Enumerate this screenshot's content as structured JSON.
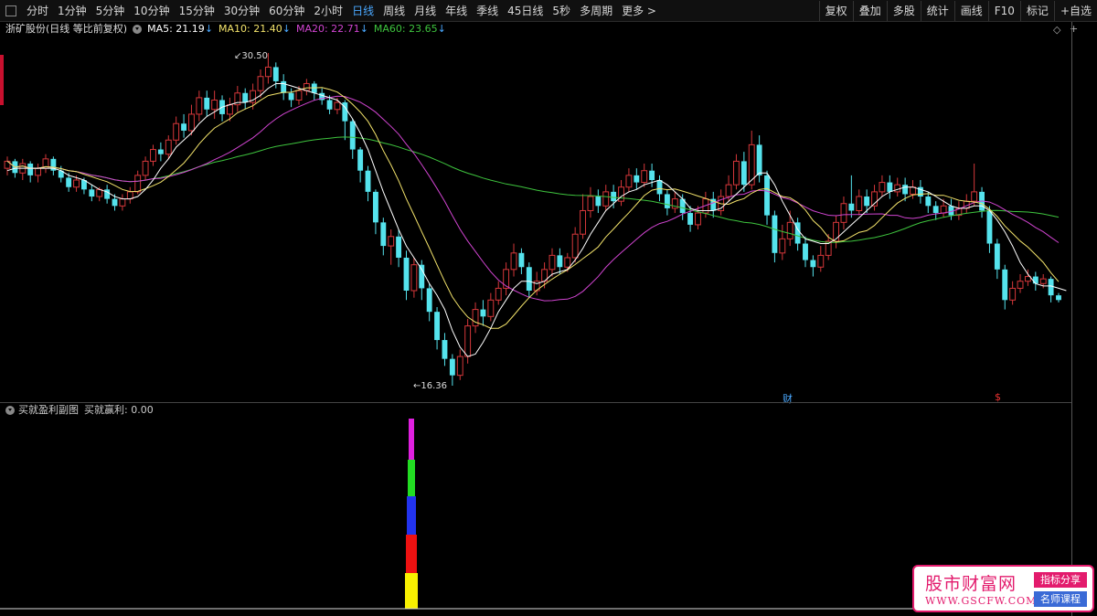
{
  "toolbar": {
    "periods": [
      "分时",
      "1分钟",
      "5分钟",
      "10分钟",
      "15分钟",
      "30分钟",
      "60分钟",
      "2小时",
      "日线",
      "周线",
      "月线",
      "年线",
      "季线",
      "45日线",
      "5秒",
      "多周期",
      "更多 >"
    ],
    "active_index": 8,
    "right_buttons": [
      "复权",
      "叠加",
      "多股",
      "统计",
      "画线",
      "F10",
      "标记",
      "+自选"
    ]
  },
  "chart_title": {
    "stock": "浙矿股份(日线 等比前复权)",
    "ma5": "MA5: 21.19",
    "ma10": "MA10: 21.40",
    "ma20": "MA20: 22.71",
    "ma60": "MA60: 23.65",
    "arrow": "↓"
  },
  "colors": {
    "up": "#d5373a",
    "down": "#55e3ed",
    "ma5": "#ffffff",
    "ma10": "#f3e36b",
    "ma20": "#d044d0",
    "ma60": "#3ec43e",
    "accent": "#4aa8ff"
  },
  "price_marks": {
    "high_label": "30.50",
    "low_label": "16.36",
    "caijin": "财",
    "dollar": "$"
  },
  "indicator": {
    "name": "买就盈利副图",
    "value_label": "买就赢利: 0.00"
  },
  "watermark": {
    "main": "股市财富网",
    "url": "WWW.GSCFW.COM",
    "tag1": "指标分享",
    "tag2": "名师课程"
  },
  "chart_data": {
    "type": "candlestick",
    "price_high": 30.5,
    "price_low": 16.36,
    "candles": [
      [
        25.6,
        25.9,
        25.3,
        26.1
      ],
      [
        25.9,
        25.4,
        25.2,
        26.0
      ],
      [
        25.4,
        25.8,
        25.1,
        26.0
      ],
      [
        25.8,
        25.3,
        25.0,
        25.9
      ],
      [
        25.3,
        25.6,
        25.0,
        25.8
      ],
      [
        25.6,
        26.0,
        25.4,
        26.2
      ],
      [
        26.0,
        25.5,
        25.3,
        26.1
      ],
      [
        25.5,
        25.2,
        25.0,
        25.7
      ],
      [
        25.2,
        24.8,
        24.6,
        25.4
      ],
      [
        24.8,
        25.1,
        24.6,
        25.3
      ],
      [
        25.1,
        24.7,
        24.5,
        25.2
      ],
      [
        24.7,
        24.4,
        24.2,
        24.9
      ],
      [
        24.4,
        24.7,
        24.2,
        24.8
      ],
      [
        24.7,
        24.3,
        24.1,
        24.9
      ],
      [
        24.3,
        24.0,
        23.8,
        24.5
      ],
      [
        24.0,
        24.3,
        23.8,
        24.5
      ],
      [
        24.3,
        24.6,
        24.1,
        24.8
      ],
      [
        24.6,
        25.3,
        24.5,
        25.5
      ],
      [
        25.3,
        25.9,
        25.1,
        26.1
      ],
      [
        25.9,
        26.4,
        25.7,
        26.6
      ],
      [
        26.4,
        26.2,
        25.9,
        26.7
      ],
      [
        26.2,
        26.8,
        26.0,
        27.0
      ],
      [
        26.8,
        27.5,
        26.6,
        27.8
      ],
      [
        27.5,
        27.2,
        26.9,
        27.9
      ],
      [
        27.2,
        27.9,
        27.0,
        28.3
      ],
      [
        27.9,
        28.6,
        27.6,
        28.9
      ],
      [
        28.6,
        28.1,
        27.8,
        28.9
      ],
      [
        28.1,
        28.5,
        27.7,
        28.9
      ],
      [
        28.5,
        27.9,
        27.6,
        28.7
      ],
      [
        27.9,
        28.3,
        27.6,
        28.6
      ],
      [
        28.3,
        28.8,
        28.0,
        29.1
      ],
      [
        28.8,
        28.4,
        28.1,
        29.0
      ],
      [
        28.4,
        28.9,
        28.1,
        29.2
      ],
      [
        28.9,
        29.5,
        28.6,
        29.8
      ],
      [
        29.5,
        29.9,
        29.2,
        30.5
      ],
      [
        29.9,
        29.3,
        29.0,
        30.1
      ],
      [
        29.3,
        28.8,
        28.5,
        29.6
      ],
      [
        28.8,
        28.5,
        28.2,
        29.0
      ],
      [
        28.5,
        28.9,
        28.3,
        29.1
      ],
      [
        28.9,
        29.2,
        28.7,
        29.4
      ],
      [
        29.2,
        28.8,
        28.5,
        29.3
      ],
      [
        28.8,
        28.5,
        28.3,
        29.0
      ],
      [
        28.5,
        28.1,
        27.9,
        28.7
      ],
      [
        28.1,
        28.4,
        27.9,
        28.6
      ],
      [
        28.4,
        27.6,
        26.8,
        28.5
      ],
      [
        27.6,
        26.4,
        26.0,
        27.7
      ],
      [
        26.4,
        25.5,
        25.0,
        26.5
      ],
      [
        25.5,
        24.6,
        24.2,
        25.7
      ],
      [
        24.6,
        23.3,
        22.8,
        24.7
      ],
      [
        23.3,
        22.3,
        21.9,
        23.5
      ],
      [
        22.3,
        22.7,
        21.5,
        23.0
      ],
      [
        22.7,
        21.8,
        21.4,
        23.0
      ],
      [
        21.8,
        20.4,
        20.0,
        22.1
      ],
      [
        20.4,
        21.5,
        20.1,
        21.8
      ],
      [
        21.5,
        20.5,
        20.0,
        21.7
      ],
      [
        20.5,
        19.5,
        19.1,
        20.7
      ],
      [
        19.5,
        18.3,
        17.9,
        19.7
      ],
      [
        18.3,
        17.5,
        17.2,
        18.6
      ],
      [
        17.5,
        16.8,
        16.36,
        17.7
      ],
      [
        16.8,
        17.6,
        16.6,
        17.9
      ],
      [
        17.6,
        18.9,
        17.3,
        19.2
      ],
      [
        18.9,
        19.6,
        18.6,
        19.9
      ],
      [
        19.6,
        19.3,
        18.9,
        20.0
      ],
      [
        19.3,
        20.0,
        19.1,
        20.3
      ],
      [
        20.0,
        20.5,
        19.8,
        20.8
      ],
      [
        20.5,
        21.3,
        20.2,
        21.6
      ],
      [
        21.3,
        22.0,
        21.0,
        22.4
      ],
      [
        22.0,
        21.4,
        21.1,
        22.2
      ],
      [
        21.4,
        20.4,
        20.1,
        21.6
      ],
      [
        20.4,
        20.8,
        20.2,
        21.2
      ],
      [
        20.8,
        21.3,
        20.5,
        21.6
      ],
      [
        21.3,
        21.9,
        21.0,
        22.2
      ],
      [
        21.9,
        21.4,
        21.1,
        22.2
      ],
      [
        21.4,
        21.8,
        21.2,
        22.0
      ],
      [
        21.8,
        22.8,
        21.6,
        23.1
      ],
      [
        22.8,
        23.8,
        22.6,
        24.5
      ],
      [
        23.8,
        24.4,
        23.5,
        24.8
      ],
      [
        24.4,
        24.0,
        23.7,
        24.7
      ],
      [
        24.0,
        24.6,
        23.8,
        24.9
      ],
      [
        24.6,
        24.2,
        23.9,
        24.9
      ],
      [
        24.2,
        24.8,
        24.0,
        25.1
      ],
      [
        24.8,
        25.3,
        24.6,
        25.6
      ],
      [
        25.3,
        25.0,
        24.7,
        25.6
      ],
      [
        25.0,
        25.5,
        24.8,
        25.8
      ],
      [
        25.5,
        25.1,
        24.8,
        25.8
      ],
      [
        25.1,
        24.5,
        24.2,
        25.3
      ],
      [
        24.5,
        23.9,
        23.6,
        24.7
      ],
      [
        23.9,
        24.3,
        23.7,
        24.6
      ],
      [
        24.3,
        23.7,
        23.4,
        24.5
      ],
      [
        23.7,
        23.2,
        22.9,
        24.0
      ],
      [
        23.2,
        23.7,
        23.0,
        24.0
      ],
      [
        23.7,
        24.3,
        23.5,
        24.6
      ],
      [
        24.3,
        23.8,
        23.5,
        24.6
      ],
      [
        23.8,
        24.4,
        23.6,
        24.7
      ],
      [
        24.4,
        24.9,
        24.2,
        25.3
      ],
      [
        24.9,
        25.9,
        24.7,
        26.2
      ],
      [
        25.9,
        24.9,
        24.6,
        26.3
      ],
      [
        24.9,
        26.6,
        24.7,
        27.2
      ],
      [
        26.6,
        25.3,
        25.0,
        27.0
      ],
      [
        25.3,
        23.6,
        23.2,
        25.5
      ],
      [
        23.6,
        22.0,
        21.6,
        23.8
      ],
      [
        22.0,
        22.6,
        21.7,
        23.2
      ],
      [
        22.6,
        23.3,
        22.3,
        23.8
      ],
      [
        23.3,
        22.4,
        22.1,
        23.5
      ],
      [
        22.4,
        21.7,
        21.4,
        22.7
      ],
      [
        21.7,
        21.4,
        21.0,
        21.9
      ],
      [
        21.4,
        21.9,
        21.2,
        22.3
      ],
      [
        21.9,
        22.5,
        21.7,
        22.8
      ],
      [
        22.5,
        23.3,
        22.2,
        23.6
      ],
      [
        23.3,
        24.1,
        23.0,
        24.4
      ],
      [
        24.1,
        23.8,
        23.5,
        25.3
      ],
      [
        23.8,
        24.4,
        23.6,
        24.7
      ],
      [
        24.4,
        24.0,
        23.7,
        24.7
      ],
      [
        24.0,
        24.6,
        23.8,
        24.9
      ],
      [
        24.6,
        25.0,
        24.4,
        25.3
      ],
      [
        25.0,
        24.6,
        24.3,
        25.3
      ],
      [
        24.6,
        24.9,
        24.4,
        25.2
      ],
      [
        24.9,
        24.5,
        24.2,
        25.2
      ],
      [
        24.5,
        24.8,
        24.3,
        25.1
      ],
      [
        24.8,
        24.4,
        24.1,
        25.1
      ],
      [
        24.4,
        24.0,
        23.7,
        24.6
      ],
      [
        24.0,
        23.7,
        23.4,
        24.2
      ],
      [
        23.7,
        24.0,
        23.5,
        24.3
      ],
      [
        24.0,
        23.6,
        23.4,
        24.3
      ],
      [
        23.6,
        23.9,
        23.4,
        24.2
      ],
      [
        23.9,
        24.2,
        23.7,
        24.5
      ],
      [
        24.2,
        24.6,
        24.0,
        25.8
      ],
      [
        24.6,
        23.8,
        23.5,
        24.8
      ],
      [
        23.8,
        22.4,
        22.0,
        24.0
      ],
      [
        22.4,
        21.3,
        20.9,
        22.6
      ],
      [
        21.3,
        20.0,
        19.6,
        21.5
      ],
      [
        20.0,
        20.5,
        19.8,
        20.8
      ],
      [
        20.5,
        20.8,
        20.3,
        21.1
      ],
      [
        20.8,
        21.0,
        20.6,
        21.3
      ],
      [
        21.0,
        20.7,
        20.4,
        21.2
      ],
      [
        20.7,
        20.9,
        20.5,
        21.1
      ],
      [
        20.9,
        20.2,
        19.9,
        21.0
      ],
      [
        20.2,
        20.0,
        19.9,
        20.3
      ]
    ],
    "ma5": [
      25.5,
      25.6,
      25.6,
      25.6,
      25.6,
      25.6,
      25.6,
      25.5,
      25.3,
      25.2,
      25.1,
      24.9,
      24.7,
      24.6,
      24.4,
      24.3,
      24.3,
      24.4,
      24.7,
      25.1,
      25.6,
      26.0,
      26.5,
      26.8,
      27.1,
      27.5,
      27.8,
      28.0,
      28.2,
      28.3,
      28.4,
      28.4,
      28.5,
      28.7,
      29.0,
      29.2,
      29.2,
      29.1,
      29.0,
      28.9,
      28.8,
      28.7,
      28.6,
      28.5,
      28.2,
      27.7,
      27.1,
      26.4,
      25.5,
      24.6,
      23.8,
      23.0,
      22.3,
      21.8,
      21.3,
      20.7,
      20.2,
      19.6,
      18.7,
      18.0,
      17.6,
      17.7,
      18.2,
      18.8,
      19.5,
      20.0,
      20.5,
      20.8,
      20.8,
      20.7,
      20.8,
      21.1,
      21.2,
      21.3,
      21.7,
      22.2,
      22.8,
      23.3,
      23.8,
      24.1,
      24.4,
      24.6,
      24.7,
      24.9,
      25.0,
      25.1,
      24.9,
      24.6,
      24.3,
      23.9,
      23.8,
      23.8,
      23.8,
      23.9,
      24.2,
      24.5,
      24.8,
      25.1,
      25.4,
      25.4,
      24.9,
      24.2,
      23.6,
      23.0,
      22.6,
      22.5,
      22.4,
      22.4,
      22.6,
      22.9,
      23.2,
      23.5,
      23.8,
      24.1,
      24.4,
      24.6,
      24.7,
      24.8,
      24.8,
      24.7,
      24.6,
      24.4,
      24.2,
      24.0,
      23.9,
      23.9,
      24.0,
      24.0,
      23.8,
      23.4,
      22.9,
      22.3,
      21.6,
      21.1,
      20.7,
      20.6,
      20.6,
      20.5,
      20.4
    ]
  }
}
